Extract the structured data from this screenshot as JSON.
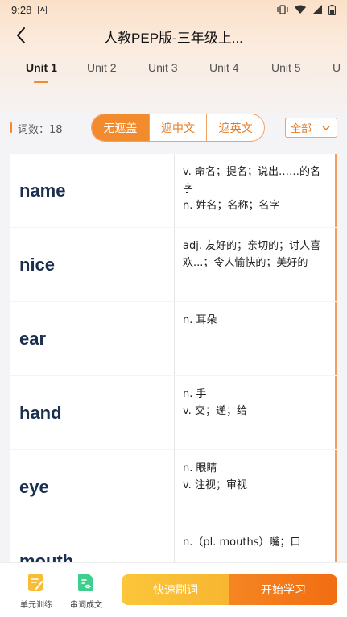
{
  "status_bar": {
    "time": "9:28",
    "notif_letter": "A"
  },
  "header": {
    "title": "人教PEP版-三年级上..."
  },
  "tabs": [
    {
      "label": "Unit 1",
      "active": true
    },
    {
      "label": "Unit 2",
      "active": false
    },
    {
      "label": "Unit 3",
      "active": false
    },
    {
      "label": "Unit 4",
      "active": false
    },
    {
      "label": "Unit 5",
      "active": false
    },
    {
      "label": "U",
      "active": false
    }
  ],
  "toolbar": {
    "count_label": "词数：18",
    "modes": [
      "无遮盖",
      "遮中文",
      "遮英文"
    ],
    "active_mode": "无遮盖",
    "filter_value": "全部"
  },
  "words": [
    {
      "word": "name",
      "meaning": "v. 命名；提名；说出……的名字\nn. 姓名；名称；名字"
    },
    {
      "word": "nice",
      "meaning": "adj. 友好的；亲切的；讨人喜欢...；令人愉快的；美好的"
    },
    {
      "word": "ear",
      "meaning": "n. 耳朵"
    },
    {
      "word": "hand",
      "meaning": "n. 手\nv. 交；递；给"
    },
    {
      "word": "eye",
      "meaning": "n. 眼睛\nv. 注视；审视"
    },
    {
      "word": "mouth",
      "meaning": "n.（pl. mouths）嘴；口"
    }
  ],
  "bottom_bar": {
    "unit_training": "单元训练",
    "sentence_building": "串词成文",
    "quick_review": "快速刷词",
    "start_learning": "开始学习"
  },
  "colors": {
    "accent": "#f28a2e",
    "word": "#1b2f4e",
    "quick": "#f9bd35"
  }
}
